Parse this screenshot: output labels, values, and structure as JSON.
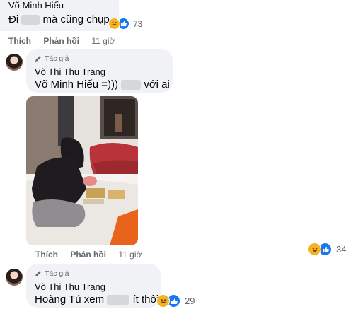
{
  "comment1": {
    "name_partial": "Võ Minh Hiếu",
    "text_before": "Đi",
    "text_after": "mà cũng chụp",
    "react_count": "73",
    "like_label": "Thích",
    "reply_label": "Phản hồi",
    "time": "11 giờ"
  },
  "comment2": {
    "role": "Tác giả",
    "name": "Võ Thị Thu Trang",
    "text_before": "Võ Minh Hiếu =)))",
    "text_after": "với ai",
    "react_count": "34",
    "like_label": "Thích",
    "reply_label": "Phản hồi",
    "time": "11 giờ"
  },
  "comment3": {
    "role": "Tác giả",
    "name": "Võ Thị Thu Trang",
    "text_before": "Hoàng Tú xem",
    "text_after": "ít thôi",
    "react_count": "29"
  },
  "colors": {
    "bubble": "#f0f2f5",
    "like_blue": "#1877f2",
    "haha_yellow": "#f7b125",
    "meta_gray": "#65676b"
  },
  "icons": [
    "pen-icon",
    "haha-reaction-icon",
    "like-reaction-icon",
    "avatar"
  ]
}
